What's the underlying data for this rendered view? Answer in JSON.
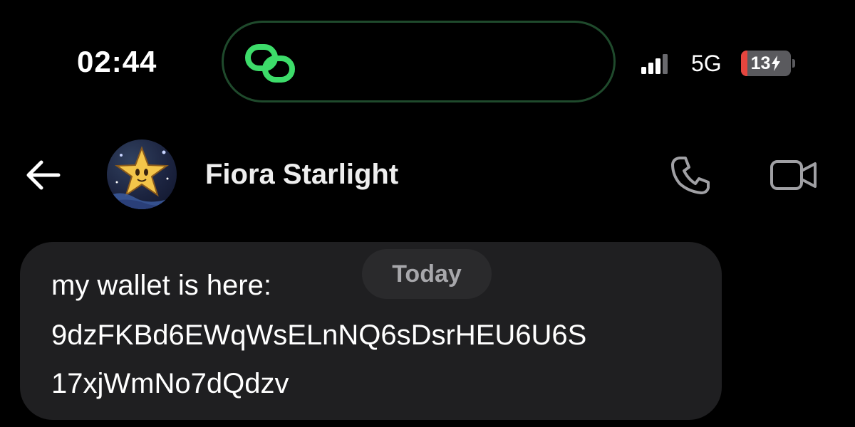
{
  "status_bar": {
    "time": "02:44",
    "island_icon": "link-rings-icon",
    "signal_icon": "cellular-signal-icon",
    "network": "5G",
    "battery": {
      "level": "13",
      "level_fraction": 0.13,
      "charging_icon": "bolt-icon",
      "color": "#e5453e"
    },
    "island_accent": "#1f4a2c",
    "island_icon_color": "#3ddc6a"
  },
  "header": {
    "back_icon": "back-arrow-icon",
    "avatar": "star-avatar",
    "contact_name": "Fiora Starlight",
    "call_icon": "phone-icon",
    "video_icon": "video-camera-icon"
  },
  "conversation": {
    "date_separator": "Today",
    "messages": [
      {
        "lines": [
          "my wallet is here:",
          "9dzFKBd6EWqWsELnNQ6sDsrHEU6U6S",
          "17xjWmNo7dQdzv"
        ]
      }
    ]
  },
  "colors": {
    "background": "#000000",
    "bubble": "#1f1f21",
    "date_pill": "#2a2a2c",
    "muted_icon": "#a0a0a4"
  }
}
